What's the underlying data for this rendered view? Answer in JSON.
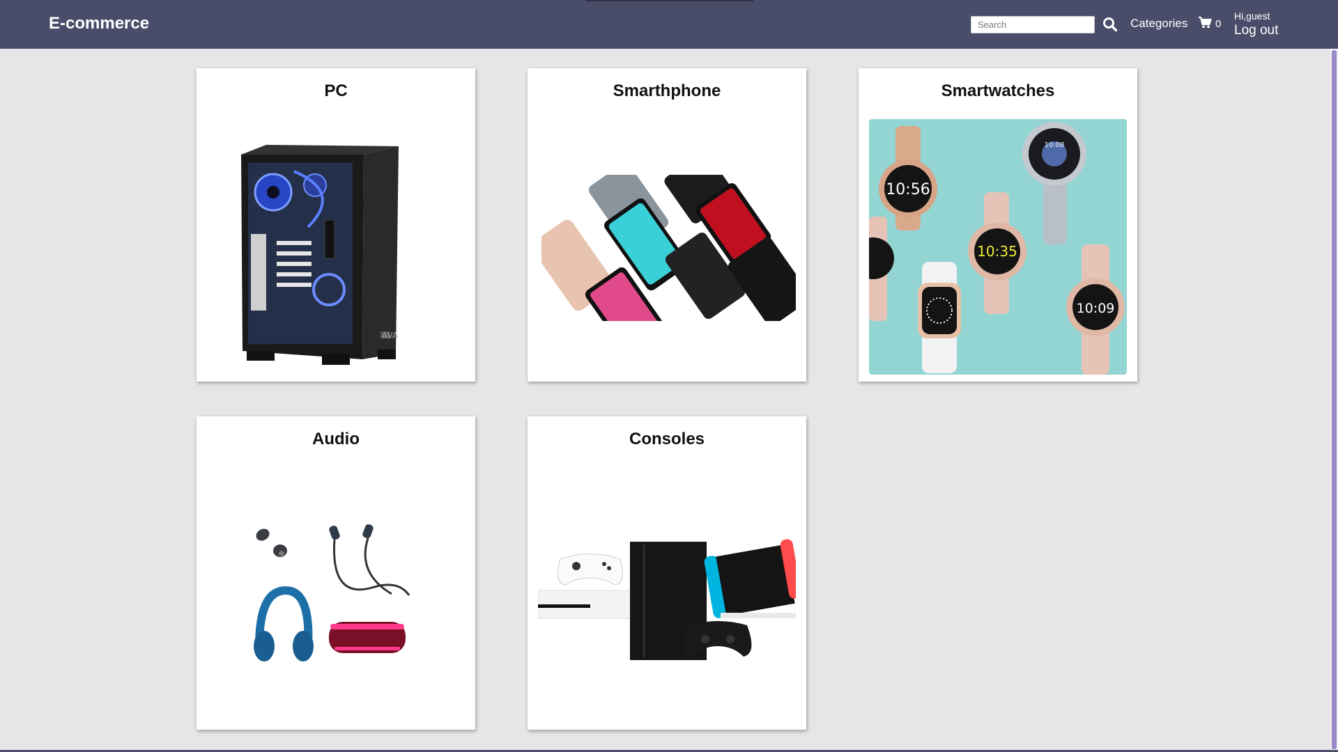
{
  "navbar": {
    "brand": "E-commerce",
    "search": {
      "placeholder": "Search",
      "value": ""
    },
    "categories_label": "Categories",
    "cart_count": "0",
    "greeting": "Hi,guest",
    "logout_label": "Log out",
    "colors": {
      "background": "#4a4d6a",
      "text": "#ffffff"
    }
  },
  "categories": [
    {
      "title": "PC",
      "image": "pc-tower-image"
    },
    {
      "title": "Smarthphone",
      "image": "smartphones-image"
    },
    {
      "title": "Smartwatches",
      "image": "smartwatches-image"
    },
    {
      "title": "Audio",
      "image": "audio-devices-image"
    },
    {
      "title": "Consoles",
      "image": "game-consoles-image"
    }
  ],
  "watch_faces": [
    "10:56",
    "10:35",
    "10:09",
    "10:08"
  ],
  "colors": {
    "page_background": "#e6e6e6",
    "card_background": "#ffffff",
    "watch_background": "#93d5d3"
  }
}
